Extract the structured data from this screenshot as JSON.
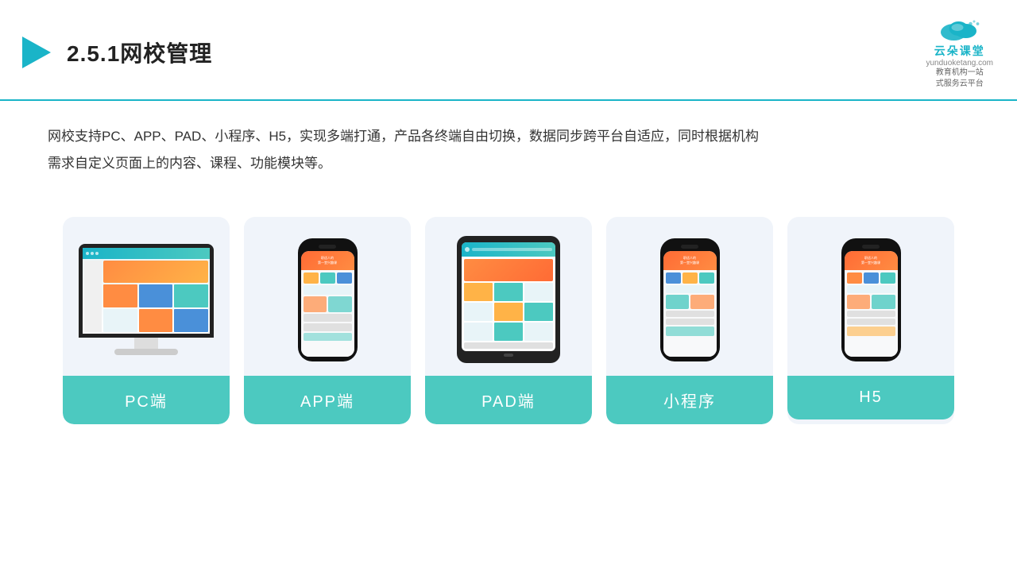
{
  "header": {
    "title": "2.5.1网校管理",
    "logo_name": "云朵课堂",
    "logo_sub_line1": "教育机构一站",
    "logo_sub_line2": "式服务云平台",
    "logo_domain": "yunduoketang.com"
  },
  "description": {
    "text1": "网校支持PC、APP、PAD、小程序、H5，实现多端打通，产品各终端自由切换，数据同步跨平台自适应，同时根据机构",
    "text2": "需求自定义页面上的内容、课程、功能模块等。"
  },
  "cards": [
    {
      "id": "pc",
      "label": "PC端"
    },
    {
      "id": "app",
      "label": "APP端"
    },
    {
      "id": "pad",
      "label": "PAD端"
    },
    {
      "id": "miniapp",
      "label": "小程序"
    },
    {
      "id": "h5",
      "label": "H5"
    }
  ],
  "accent_color": "#4cc9c0",
  "border_color": "#1ab4c8"
}
